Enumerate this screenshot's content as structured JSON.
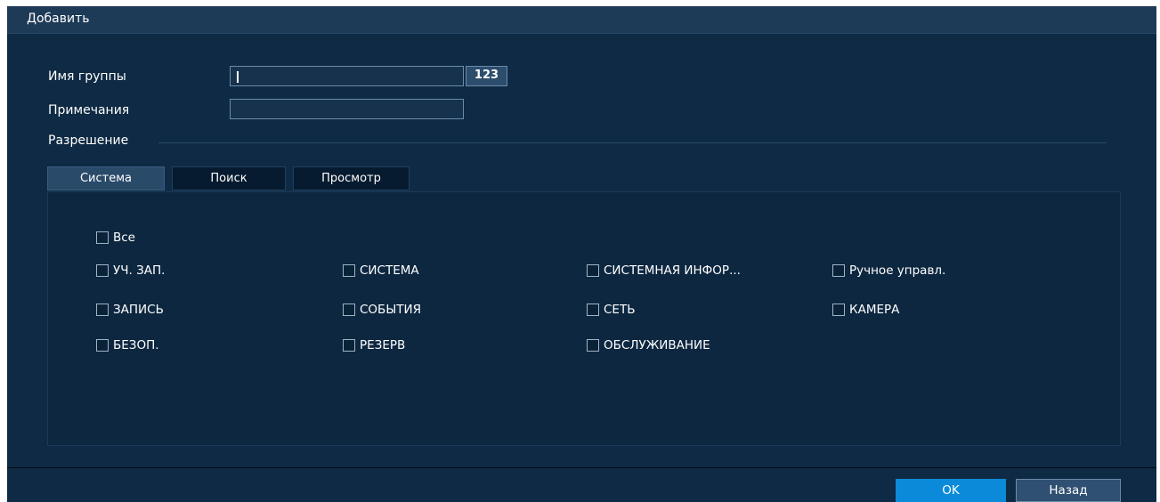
{
  "window": {
    "title": "Добавить"
  },
  "form": {
    "group_name_label": "Имя группы",
    "group_name_value": "",
    "keyboard_button": "123",
    "notes_label": "Примечания",
    "notes_value": "",
    "permission_label": "Разрешение"
  },
  "tabs": [
    {
      "label": "Система",
      "active": true
    },
    {
      "label": "Поиск",
      "active": false
    },
    {
      "label": "Просмотр",
      "active": false
    }
  ],
  "permissions": {
    "all": {
      "label": "Все",
      "checked": false
    },
    "items": [
      {
        "label": "УЧ. ЗАП.",
        "checked": false
      },
      {
        "label": "СИСТЕМА",
        "checked": false
      },
      {
        "label": "СИСТЕМНАЯ ИНФОР...",
        "checked": false
      },
      {
        "label": "Ручное управл.",
        "checked": false
      },
      {
        "label": "ЗАПИСЬ",
        "checked": false
      },
      {
        "label": "СОБЫТИЯ",
        "checked": false
      },
      {
        "label": "СЕТЬ",
        "checked": false
      },
      {
        "label": "КАМЕРА",
        "checked": false
      },
      {
        "label": "БЕЗОП.",
        "checked": false
      },
      {
        "label": "РЕЗЕРВ",
        "checked": false
      },
      {
        "label": "ОБСЛУЖИВАНИЕ",
        "checked": false
      }
    ]
  },
  "footer": {
    "ok_label": "OK",
    "back_label": "Назад"
  },
  "colors": {
    "background": "#0e2a44",
    "title_bar": "#1d3a57",
    "accent": "#0b8ad9"
  }
}
